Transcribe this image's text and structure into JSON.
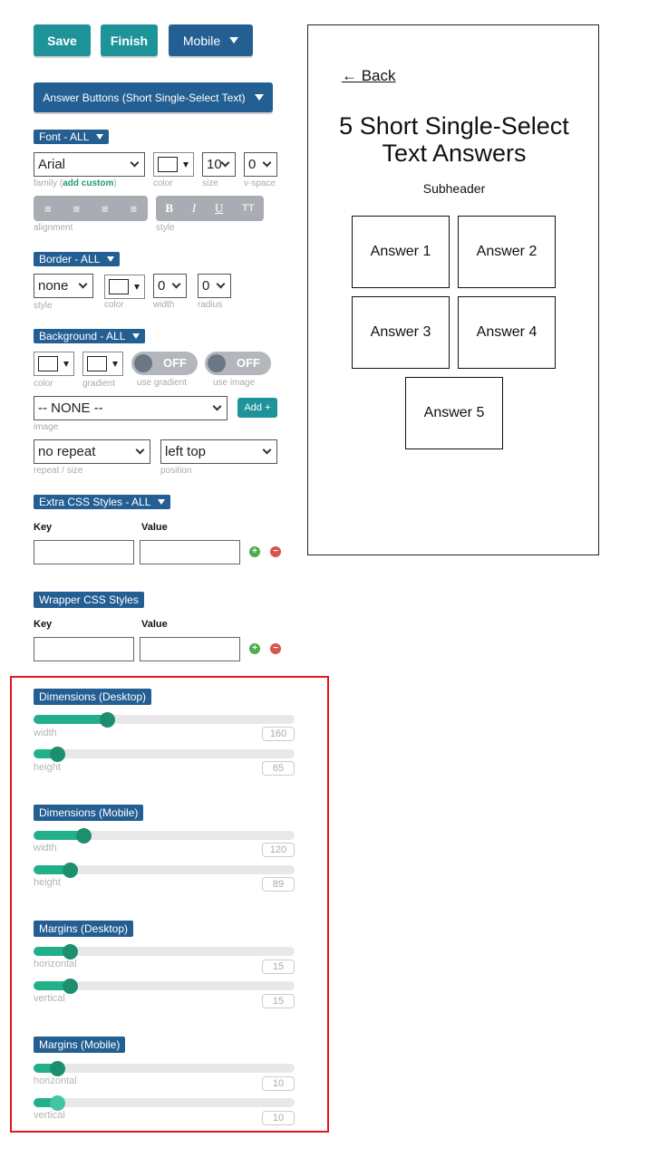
{
  "toolbar": {
    "save": "Save",
    "finish": "Finish",
    "device": "Mobile"
  },
  "element_selector": "Answer Buttons (Short Single-Select Text)",
  "font": {
    "header": "Font - ALL",
    "family": "Arial",
    "family_label": "family (",
    "add_custom": "add custom",
    "family_label_end": ")",
    "color_label": "color",
    "size": "10",
    "size_label": "size",
    "vspace": "0",
    "vspace_label": "v-space",
    "alignment_label": "alignment",
    "style_label": "style",
    "style_buttons": [
      "B",
      "I",
      "U",
      "TT"
    ]
  },
  "border": {
    "header": "Border - ALL",
    "style": "none",
    "style_label": "style",
    "color_label": "color",
    "width": "0",
    "width_label": "width",
    "radius": "0",
    "radius_label": "radius"
  },
  "background": {
    "header": "Background - ALL",
    "color_label": "color",
    "gradient_label": "gradient",
    "use_gradient": "OFF",
    "use_gradient_label": "use gradient",
    "use_image": "OFF",
    "use_image_label": "use image",
    "image": "-- NONE --",
    "image_label": "image",
    "add_button": "Add +",
    "repeat": "no repeat",
    "repeat_label": "repeat / size",
    "position": "left top",
    "position_label": "position"
  },
  "extra_css": {
    "header": "Extra CSS Styles - ALL",
    "key_label": "Key",
    "value_label": "Value",
    "key": "",
    "value": ""
  },
  "wrapper_css": {
    "header": "Wrapper CSS Styles",
    "key_label": "Key",
    "value_label": "Value",
    "key": "",
    "value": ""
  },
  "dimensions_desktop": {
    "header": "Dimensions (Desktop)",
    "width_label": "width",
    "width": "160",
    "width_fraction": 0.28,
    "height_label": "height",
    "height": "65",
    "height_fraction": 0.09
  },
  "dimensions_mobile": {
    "header": "Dimensions (Mobile)",
    "width_label": "width",
    "width": "120",
    "width_fraction": 0.19,
    "height_label": "height",
    "height": "89",
    "height_fraction": 0.14
  },
  "margins_desktop": {
    "header": "Margins (Desktop)",
    "horizontal_label": "horizontal",
    "horizontal": "15",
    "horizontal_fraction": 0.14,
    "vertical_label": "vertical",
    "vertical": "15",
    "vertical_fraction": 0.14
  },
  "margins_mobile": {
    "header": "Margins (Mobile)",
    "horizontal_label": "horizontal",
    "horizontal": "10",
    "horizontal_fraction": 0.09,
    "vertical_label": "vertical",
    "vertical": "10",
    "vertical_fraction": 0.09
  },
  "preview": {
    "back": "← Back",
    "title_line1": "5 Short Single-Select",
    "title_line2": "Text Answers",
    "subheader": "Subheader",
    "answers": [
      "Answer 1",
      "Answer 2",
      "Answer 3",
      "Answer 4",
      "Answer 5"
    ]
  },
  "colors": {
    "teal": "#1e939a",
    "blue": "#245f93",
    "slider_fill": "#22b08a",
    "slider_thumb": "#1e8f6e",
    "highlight": "#e3161e"
  }
}
